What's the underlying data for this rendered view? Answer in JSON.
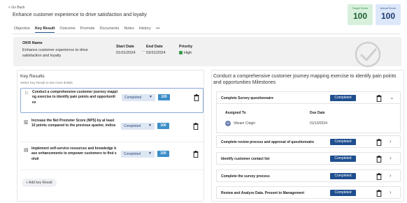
{
  "header": {
    "back_label": "< Go Back",
    "title": "Enhance customer experience to drive satisfaction and loyalty",
    "target_score": {
      "label": "Target Score",
      "value": "100"
    },
    "actual_score": {
      "label": "Actual Score",
      "value": "100"
    }
  },
  "tabs": [
    "Objective",
    "Key Result",
    "Outcome",
    "Promote",
    "Documents",
    "Notes",
    "History",
    "•••"
  ],
  "active_tab": "Key Result",
  "okr": {
    "name_label": "OKR Name",
    "name_value": "Enhance customer experience to drive satisfaction and loyalty",
    "start_label": "Start Date",
    "start_value": "01/01/2024",
    "dash": "—",
    "end_label": "End Date",
    "end_value": "03/31/2024",
    "priority_label": "Priority",
    "priority_value": "High",
    "priority_color": "#3a9a4a"
  },
  "key_results": {
    "title": "Key Results",
    "subtitle": "Select Key Result to see more details",
    "items": [
      {
        "icon": "flag-icon",
        "text": "Conduct a comprehensive customer journey mappi ng exercise to identify pain points and opportuniti es",
        "status": "Completed",
        "score": "100"
      },
      {
        "icon": "bar-chart-icon",
        "text": "Increase the Net Promoter Score (NPS) by at least 10 points compared to the previous quarter, indica",
        "status": "Completed",
        "score": "100"
      },
      {
        "icon": "document-icon",
        "text": "Implement self-service resources and knowledge b ase enhancements to empower customers to find s oluti",
        "status": "Completed",
        "score": "100"
      }
    ],
    "add_label": "+ Add key Result"
  },
  "milestones": {
    "title": "Conduct a comprehensive customer journey mapping exercise to identify pain points and opportunities Milestones",
    "items": [
      {
        "label": "Complete Survey questionnaire",
        "status": "Completed",
        "expanded": true
      },
      {
        "label": "Complete review process and approval of questionnaire",
        "status": "Completed"
      },
      {
        "label": "Identify customer contact list",
        "status": "Completed"
      },
      {
        "label": "Complete the survey process",
        "status": "Completed"
      },
      {
        "label": "Review and Analyze Data. Present to Management",
        "status": "Completed"
      }
    ],
    "detail": {
      "assigned_label": "Assigned To",
      "assigned_initials": "VC",
      "assigned_value": "Vikram Cirigiri",
      "due_label": "Due Date",
      "due_value": "01/13/2024"
    }
  }
}
